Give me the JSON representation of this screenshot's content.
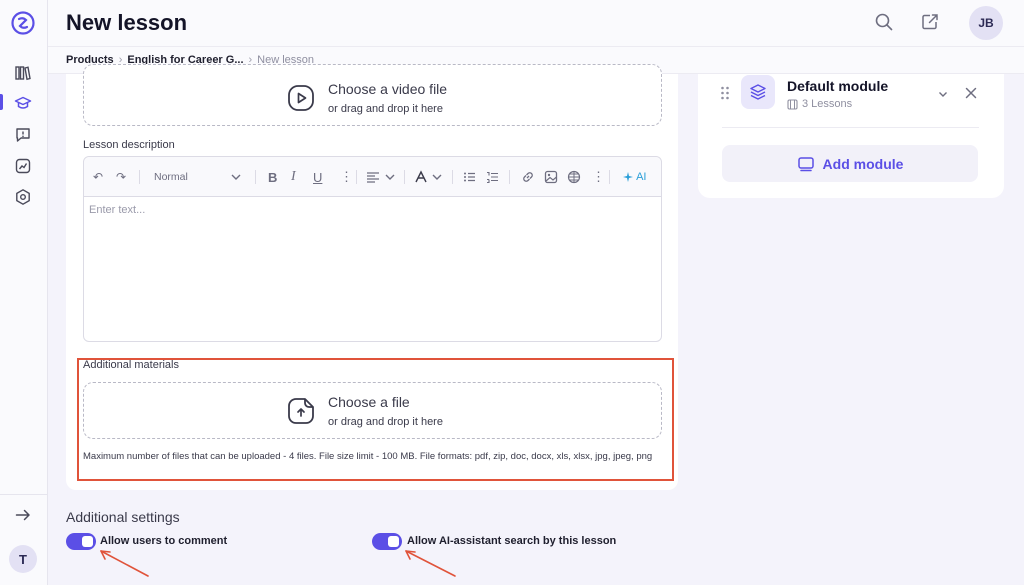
{
  "header": {
    "title": "New lesson",
    "avatar_initials": "JB"
  },
  "breadcrumb": {
    "items": [
      "Products",
      "English for Career G...",
      "New lesson"
    ]
  },
  "sidebar": {
    "bottom_avatar": "T",
    "icons": [
      "logo-icon",
      "library-icon",
      "graduation-cap-icon",
      "chat-alert-icon",
      "analytics-icon",
      "settings-icon",
      "arrow-right-icon"
    ]
  },
  "video": {
    "title": "Choose a video file",
    "subtitle": "or drag and drop it here"
  },
  "description": {
    "label": "Lesson description",
    "placeholder": "Enter text...",
    "toolbar": {
      "format": "Normal",
      "ai": "AI"
    }
  },
  "materials": {
    "label": "Additional materials",
    "title": "Choose a file",
    "subtitle": "or drag and drop it here",
    "hint": "Maximum number of files that can be uploaded - 4 files. File size limit - 100 MB. File formats: pdf, zip, doc, docx, xls, xlsx, jpg, jpeg, png"
  },
  "module": {
    "title": "Default module",
    "lessons": "3 Lessons",
    "add_label": "Add module"
  },
  "settings": {
    "title": "Additional settings",
    "allow_comments": {
      "label": "Allow users to comment",
      "enabled": true
    },
    "allow_ai_search": {
      "label": "Allow AI-assistant search by this lesson",
      "enabled": true
    }
  },
  "colors": {
    "accent": "#5b4fe6",
    "highlight": "#e0533a"
  }
}
